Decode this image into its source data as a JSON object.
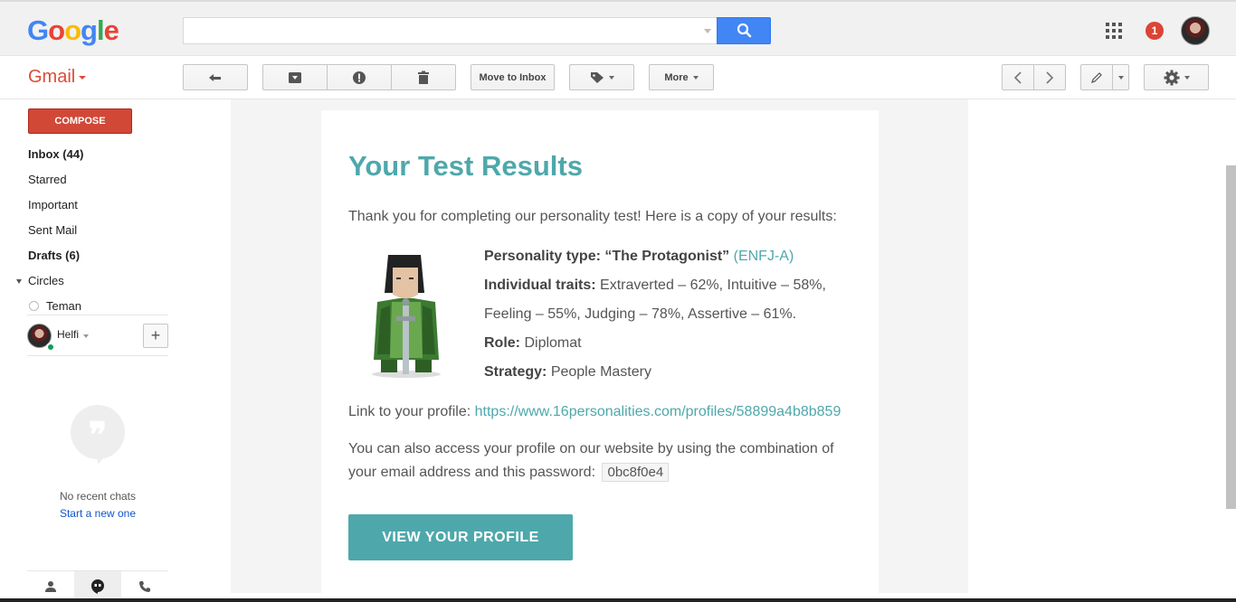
{
  "header": {
    "logo_letters": [
      {
        "char": "G",
        "color": "#4285f4"
      },
      {
        "char": "o",
        "color": "#ea4335"
      },
      {
        "char": "o",
        "color": "#fbbc05"
      },
      {
        "char": "g",
        "color": "#4285f4"
      },
      {
        "char": "l",
        "color": "#34a853"
      },
      {
        "char": "e",
        "color": "#ea4335"
      }
    ],
    "search_value": "",
    "notification_count": "1"
  },
  "toolbar": {
    "app_label": "Gmail",
    "move_to_inbox": "Move to Inbox",
    "more": "More"
  },
  "sidebar": {
    "compose": "COMPOSE",
    "items": [
      {
        "label": "Inbox (44)",
        "bold": true
      },
      {
        "label": "Starred",
        "bold": false
      },
      {
        "label": "Important",
        "bold": false
      },
      {
        "label": "Sent Mail",
        "bold": false
      },
      {
        "label": "Drafts (6)",
        "bold": true
      },
      {
        "label": "Circles",
        "bold": false
      },
      {
        "label": "Teman",
        "bold": false
      }
    ],
    "user_name": "Helfi",
    "no_chats": "No recent chats",
    "start_new": "Start a new one"
  },
  "email": {
    "title": "Your Test Results",
    "intro": "Thank you for completing our personality test! Here is a copy of your results:",
    "personality_label": "Personality type:",
    "personality_name": "“The Protagonist”",
    "personality_code": "(ENFJ-A)",
    "traits_label": "Individual traits:",
    "traits_line1": "Extraverted – 62%, Intuitive – 58%,",
    "traits_line2": "Feeling – 55%, Judging – 78%, Assertive – 61%.",
    "role_label": "Role:",
    "role_value": "Diplomat",
    "strategy_label": "Strategy:",
    "strategy_value": "People Mastery",
    "link_label": "Link to your profile:",
    "link_url": "https://www.16personalities.com/profiles/58899a4b8b859",
    "access_line1": "You can also access your profile on our website by using the combination of",
    "access_line2": "your email address and this password:",
    "password": "0bc8f0e4",
    "button": "VIEW YOUR PROFILE"
  },
  "colors": {
    "accent": "#4ea8ab",
    "compose": "#d14836",
    "search_button": "#4285f4"
  }
}
